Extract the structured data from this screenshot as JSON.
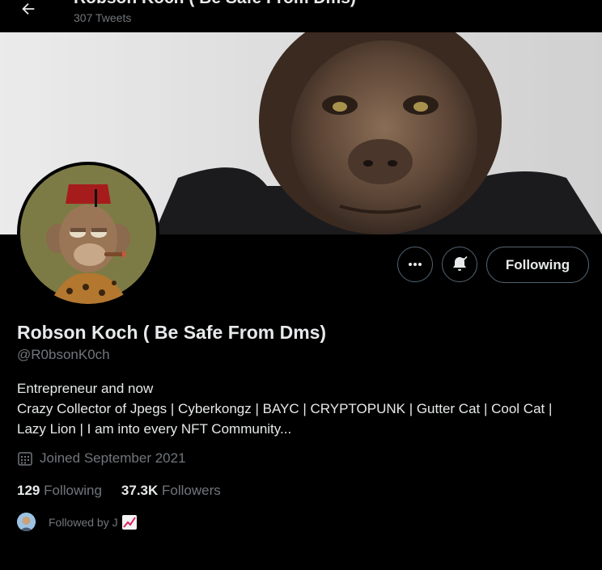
{
  "header": {
    "title": "Robson Koch ( Be Safe From Dms)",
    "tweet_count": "307 Tweets"
  },
  "actions": {
    "follow_label": "Following"
  },
  "profile": {
    "name": "Robson Koch ( Be Safe From Dms)",
    "handle": "@R0bsonK0ch",
    "bio_lines": [
      "Entrepreneur and now",
      "Crazy Collector of Jpegs | Cyberkongz | BAYC | CRYPTOPUNK | Gutter Cat | Cool Cat |",
      "Lazy Lion | I am into every NFT Community..."
    ],
    "joined": "Joined September 2021",
    "following_count": "129",
    "following_label": "Following",
    "followers_count": "37.3K",
    "followers_label": "Followers",
    "followed_by": "Followed by J"
  },
  "icons": {
    "back": "arrow-left-icon",
    "more": "more-icon",
    "notify": "bell-check-icon",
    "calendar": "calendar-icon",
    "chart": "chart-increasing-emoji"
  }
}
